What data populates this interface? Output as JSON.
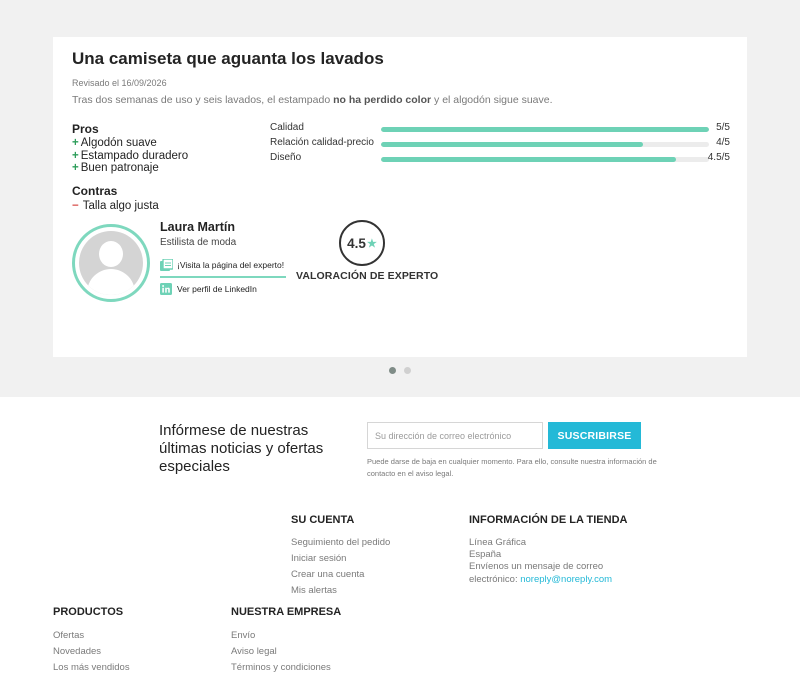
{
  "review": {
    "title": "Una camiseta que aguanta los lavados",
    "date": "Revisado el 16/09/2026",
    "text_before": "Tras dos semanas de uso y seis lavados, el estampado ",
    "text_bold": "no ha perdido color",
    "text_after": " y el algodón sigue suave.",
    "pros_title": "Pros",
    "pros": [
      "Algodón suave",
      "Estampado duradero",
      "Buen patronaje"
    ],
    "cons_title": "Contras",
    "cons": [
      "Talla algo justa"
    ],
    "plus_symbol": "+",
    "minus_symbol": "−",
    "ratings": [
      {
        "label": "Calidad",
        "value": "5/5",
        "fraction": 1.0
      },
      {
        "label": "Relación calidad-precio",
        "value": "4/5",
        "fraction": 0.8
      },
      {
        "label": "Diseño",
        "value": "4.5/5",
        "fraction": 0.9
      }
    ],
    "accent_color": "#6ed2b6"
  },
  "expert": {
    "name": "Laura Martín",
    "role": "Estilista de moda",
    "page_link": "¡Visita la página del experto!",
    "linkedin_link": "Ver perfil de LinkedIn",
    "score": "4.5",
    "score_label": "VALORACIÓN DE EXPERTO",
    "star": "★"
  },
  "carousel": {
    "dots": 2,
    "active": 0
  },
  "newsletter": {
    "text": "Infórmese de nuestras últimas noticias y ofertas especiales",
    "placeholder": "Su dirección de correo electrónico",
    "button": "SUSCRIBIRSE",
    "note": "Puede darse de baja en cualquier momento. Para ello, consulte nuestra información de contacto en el aviso legal.",
    "button_color": "#24b9d7"
  },
  "footer": {
    "account": {
      "heading": "SU CUENTA",
      "links": [
        "Seguimiento del pedido",
        "Iniciar sesión",
        "Crear una cuenta",
        "Mis alertas"
      ]
    },
    "store": {
      "heading": "INFORMACIÓN DE LA TIENDA",
      "name": "Línea Gráfica",
      "country": "España",
      "contact_text": "Envíenos un mensaje de correo electrónico: ",
      "email": "noreply@noreply.com"
    },
    "products": {
      "heading": "PRODUCTOS",
      "links": [
        "Ofertas",
        "Novedades",
        "Los más vendidos"
      ]
    },
    "company": {
      "heading": "NUESTRA EMPRESA",
      "links": [
        "Envío",
        "Aviso legal",
        "Términos y condiciones"
      ]
    }
  }
}
